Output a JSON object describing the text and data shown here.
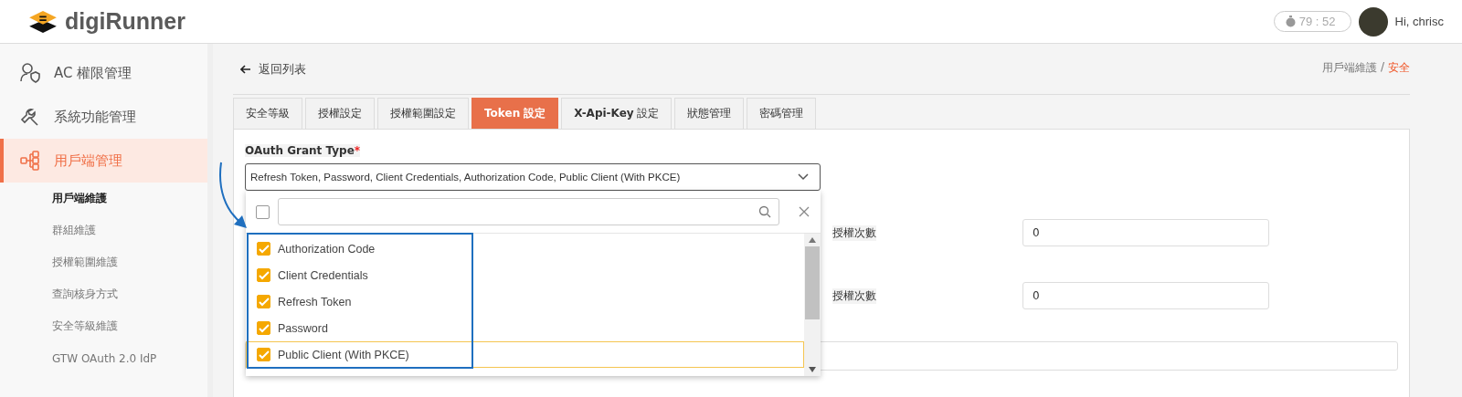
{
  "header": {
    "logo": "**digi**Runner",
    "timer": "79 : 52",
    "greeting": "Hi, chrisc"
  },
  "sidebar": {
    "items": [
      {
        "label": "AC 權限管理",
        "selected": false
      },
      {
        "label": "系統功能管理",
        "selected": false
      },
      {
        "label": "用戶端管理",
        "selected": true
      }
    ],
    "sub_items": [
      {
        "label": "用戶端維護",
        "selected": true
      },
      {
        "label": "群組維護",
        "selected": false
      },
      {
        "label": "授權範圍維護",
        "selected": false
      },
      {
        "label": "查詢核身方式",
        "selected": false
      },
      {
        "label": "安全等級維護",
        "selected": false
      },
      {
        "label": "GTW OAuth 2.0 IdP",
        "selected": false
      }
    ]
  },
  "back_link": "返回列表",
  "breadcrumb_separator": "/",
  "breadcrumb": [
    {
      "label": "用戶端維護",
      "selected": false
    },
    {
      "label": "安全",
      "selected": true
    }
  ],
  "tabs": [
    {
      "label": "安全等級",
      "selected": false
    },
    {
      "label": "授權設定",
      "selected": false
    },
    {
      "label": "授權範圍設定",
      "selected": false
    },
    {
      "label": "Token 設定",
      "selected": true
    },
    {
      "label": "**X-Api-Key** 設定",
      "selected": false
    },
    {
      "label": "狀態管理",
      "selected": false
    },
    {
      "label": "密碼管理",
      "selected": false
    }
  ],
  "grant_type": {
    "label": "OAuth Grant Type",
    "required": true,
    "required_mark": "*",
    "value": "Refresh Token, Password, Client Credentials, Authorization Code, Public Client (With PKCE)",
    "dropdown": {
      "select_all_checked": false,
      "options": [
        {
          "label": "Authorization Code",
          "checked": true,
          "highlighted": false
        },
        {
          "label": "Client Credentials",
          "checked": true,
          "highlighted": false
        },
        {
          "label": "Refresh Token",
          "checked": true,
          "highlighted": false
        },
        {
          "label": "Password",
          "checked": true,
          "highlighted": false
        },
        {
          "label": "Public Client (With PKCE)",
          "checked": true,
          "highlighted": true
        }
      ]
    }
  },
  "fields": [
    {
      "label": "授權次數",
      "value": "0"
    },
    {
      "label": "授權次數",
      "value": "0"
    }
  ]
}
